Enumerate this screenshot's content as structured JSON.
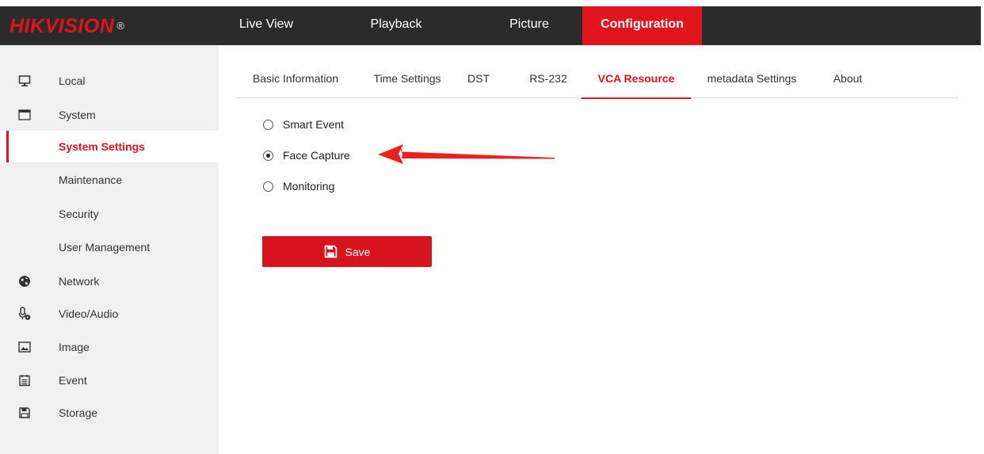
{
  "brand": {
    "name_prefix": "HIK",
    "name_rest": "VISION",
    "mark": "®"
  },
  "colors": {
    "accent": "#e1141e",
    "topbar": "#2b2b2b",
    "sidebar": "#f0f0f0"
  },
  "nav": {
    "items": [
      {
        "label": "Live View"
      },
      {
        "label": "Playback"
      },
      {
        "label": "Picture"
      },
      {
        "label": "Configuration",
        "active": true
      }
    ]
  },
  "sidebar": {
    "items": [
      {
        "label": "Local",
        "icon": "monitor-icon"
      },
      {
        "label": "System",
        "icon": "window-icon"
      },
      {
        "label": "System Settings",
        "active": true
      },
      {
        "label": "Maintenance"
      },
      {
        "label": "Security"
      },
      {
        "label": "User Management"
      },
      {
        "label": "Network",
        "icon": "globe-icon"
      },
      {
        "label": "Video/Audio",
        "icon": "microphone-icon"
      },
      {
        "label": "Image",
        "icon": "image-icon"
      },
      {
        "label": "Event",
        "icon": "calendar-icon"
      },
      {
        "label": "Storage",
        "icon": "floppy-icon"
      }
    ]
  },
  "tabs": {
    "items": [
      {
        "label": "Basic Information"
      },
      {
        "label": "Time Settings"
      },
      {
        "label": "DST"
      },
      {
        "label": "RS-232"
      },
      {
        "label": "VCA Resource",
        "active": true
      },
      {
        "label": "metadata Settings"
      },
      {
        "label": "About"
      }
    ]
  },
  "vca": {
    "options": [
      {
        "label": "Smart Event",
        "checked": false
      },
      {
        "label": "Face Capture",
        "checked": true
      },
      {
        "label": "Monitoring",
        "checked": false
      }
    ]
  },
  "actions": {
    "save_label": "Save"
  }
}
